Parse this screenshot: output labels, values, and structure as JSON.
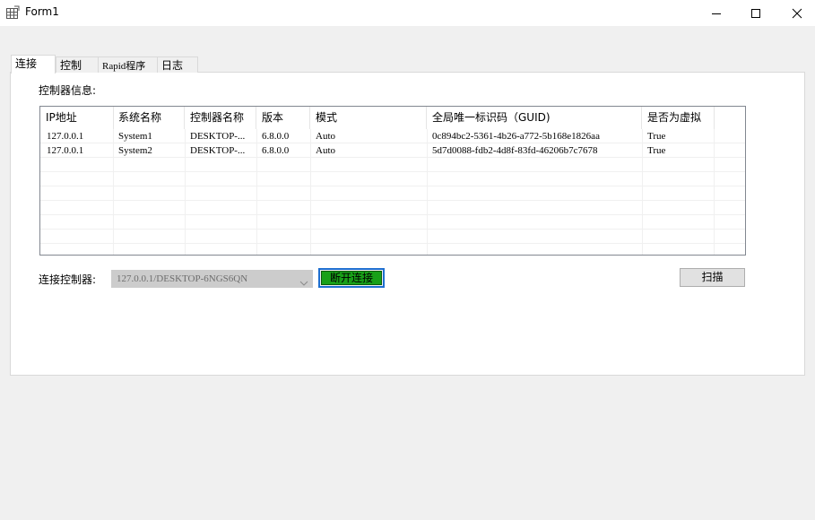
{
  "window": {
    "title": "Form1",
    "icon": "grid-form-icon",
    "controls": [
      "minimize-icon",
      "maximize-icon",
      "close-icon"
    ]
  },
  "tabs": [
    {
      "label": "连接",
      "active": true
    },
    {
      "label": "控制",
      "active": false
    },
    {
      "label": "Rapid程序",
      "active": false
    },
    {
      "label": "日志",
      "active": false
    }
  ],
  "connection_tab": {
    "info_label": "控制器信息:",
    "columns": [
      "IP地址",
      "系统名称",
      "控制器名称",
      "版本",
      "模式",
      "全局唯一标识码（GUID)",
      "是否为虚拟"
    ],
    "rows": [
      [
        "127.0.0.1",
        "System1",
        "DESKTOP-...",
        "6.8.0.0",
        "Auto",
        "0c894bc2-5361-4b26-a772-5b168e1826aa",
        "True"
      ],
      [
        "127.0.0.1",
        "System2",
        "DESKTOP-...",
        "6.8.0.0",
        "Auto",
        "5d7d0088-fdb2-4d8f-83fd-46206b7c7678",
        "True"
      ]
    ],
    "connect_label": "连接控制器:",
    "controller_select": {
      "value": "127.0.0.1/DESKTOP-6NGS6QN",
      "enabled": false
    },
    "disconnect_button": "断开连接",
    "scan_button": "扫描"
  },
  "colors": {
    "disconnect_fill": "#18a018",
    "focus_border": "#1e6fd0"
  }
}
